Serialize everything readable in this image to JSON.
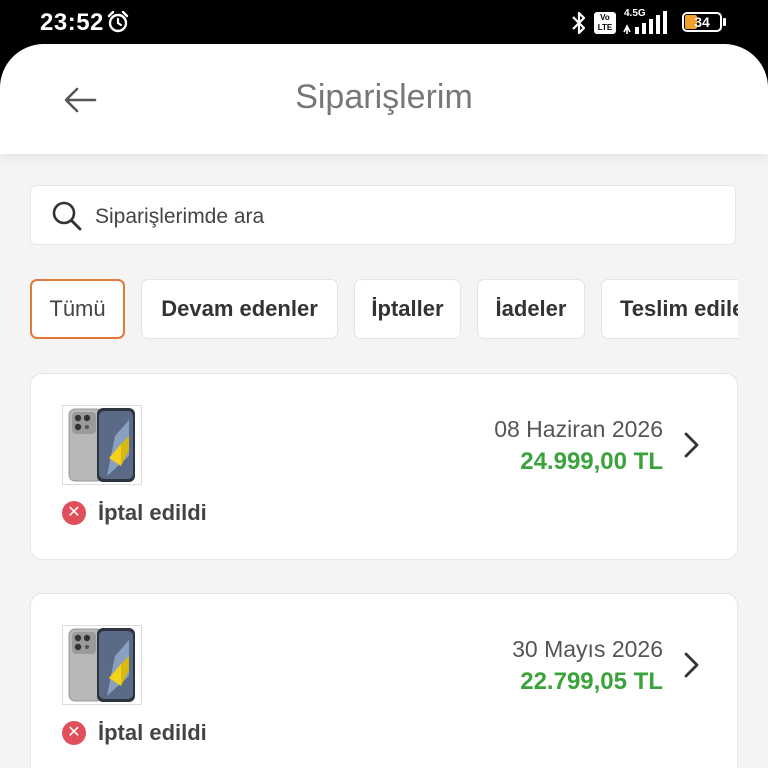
{
  "status_bar": {
    "time": "23:52",
    "network_label": "4.5G",
    "volte_label": "Vo LTE",
    "battery_level": "34"
  },
  "header": {
    "title": "Siparişlerim"
  },
  "search": {
    "placeholder": "Siparişlerimde ara"
  },
  "filters": [
    {
      "label": "Tümü",
      "active": true
    },
    {
      "label": "Devam edenler",
      "active": false
    },
    {
      "label": "İptaller",
      "active": false
    },
    {
      "label": "İadeler",
      "active": false
    },
    {
      "label": "Teslim edilenler",
      "active": false
    }
  ],
  "orders": [
    {
      "date": "08 Haziran 2026",
      "price": "24.999,00 TL",
      "status": "İptal edildi"
    },
    {
      "date": "30 Mayıs 2026",
      "price": "22.799,05 TL",
      "status": "İptal edildi"
    }
  ],
  "colors": {
    "accent": "#e2793a",
    "price_green": "#3ba33b",
    "cancel_red": "#e0505a"
  },
  "icons": {
    "back": "arrow-left-icon",
    "search": "search-icon",
    "chevron": "chevron-right-icon",
    "status": "cancel-x-icon",
    "alarm": "alarm-clock-icon",
    "bluetooth": "bluetooth-icon",
    "signal": "signal-icon",
    "battery": "battery-icon"
  }
}
